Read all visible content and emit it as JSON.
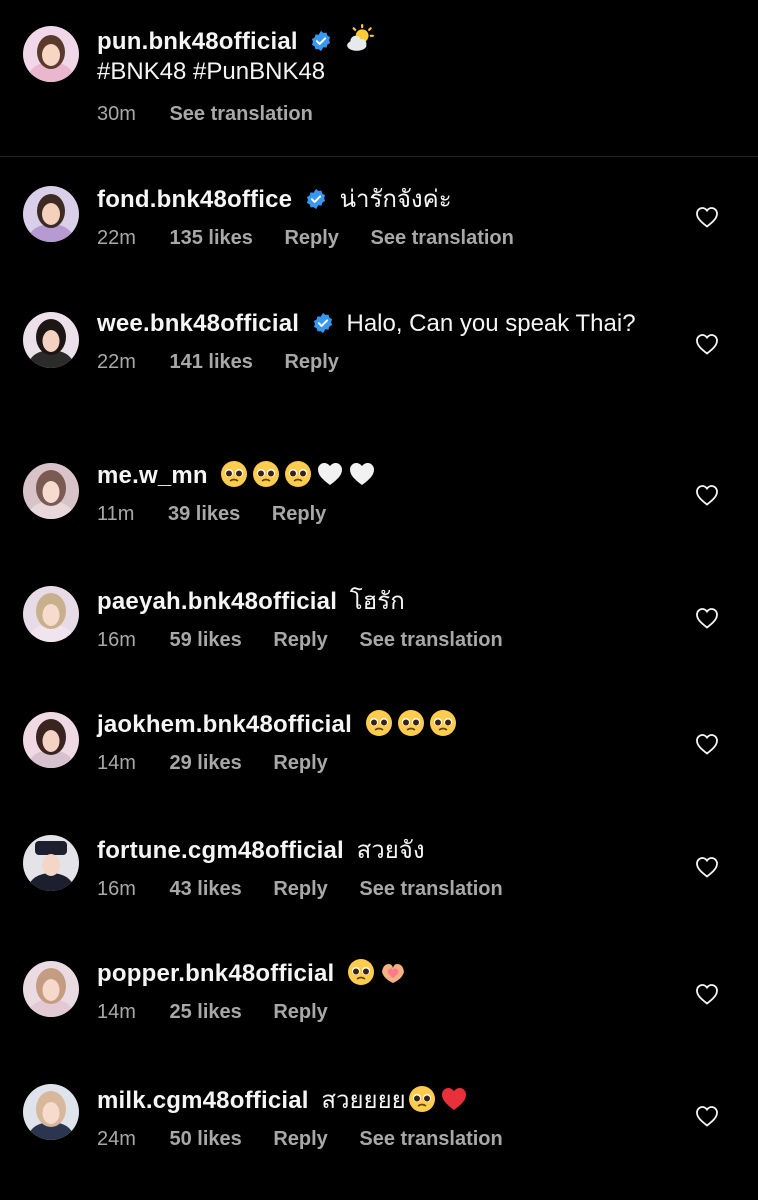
{
  "caption": {
    "username": "pun.bnk48official",
    "verified": true,
    "weather_emoji": "sun-behind-cloud",
    "text": "#BNK48 #PunBNK48",
    "time": "30m",
    "see_translation": "See translation"
  },
  "comments": [
    {
      "username": "fond.bnk48office",
      "verified": true,
      "text": "น่ารักจังค่ะ",
      "time": "22m",
      "likes": "135 likes",
      "reply": "Reply",
      "see_translation": "See translation"
    },
    {
      "username": "wee.bnk48official",
      "verified": true,
      "text": "Halo, Can you speak Thai?",
      "time": "22m",
      "likes": "141 likes",
      "reply": "Reply"
    },
    {
      "username": "me.w_mn",
      "verified": false,
      "emojis": [
        "pleading-face",
        "pleading-face",
        "pleading-face",
        "white-heart",
        "white-heart"
      ],
      "time": "11m",
      "likes": "39 likes",
      "reply": "Reply"
    },
    {
      "username": "paeyah.bnk48official",
      "verified": false,
      "text": "โฮรัก",
      "time": "16m",
      "likes": "59 likes",
      "reply": "Reply",
      "see_translation": "See translation"
    },
    {
      "username": "jaokhem.bnk48official",
      "verified": false,
      "emojis": [
        "pleading-face",
        "pleading-face",
        "pleading-face"
      ],
      "time": "14m",
      "likes": "29 likes",
      "reply": "Reply"
    },
    {
      "username": "fortune.cgm48official",
      "verified": false,
      "text": "สวยจัง",
      "time": "16m",
      "likes": "43 likes",
      "reply": "Reply",
      "see_translation": "See translation"
    },
    {
      "username": "popper.bnk48official",
      "verified": false,
      "emojis": [
        "pleading-face",
        "heart-hands"
      ],
      "time": "14m",
      "likes": "25 likes",
      "reply": "Reply"
    },
    {
      "username": "milk.cgm48official",
      "verified": false,
      "text": "สวยยยย",
      "emojis": [
        "pleading-face",
        "red-heart"
      ],
      "time": "24m",
      "likes": "50 likes",
      "reply": "Reply",
      "see_translation": "See translation"
    }
  ],
  "colors": {
    "background": "#000000",
    "primary_text": "#f5f5f5",
    "secondary_text": "#a8a8a8",
    "verified_blue": "#3897f0",
    "divider": "#262626"
  }
}
